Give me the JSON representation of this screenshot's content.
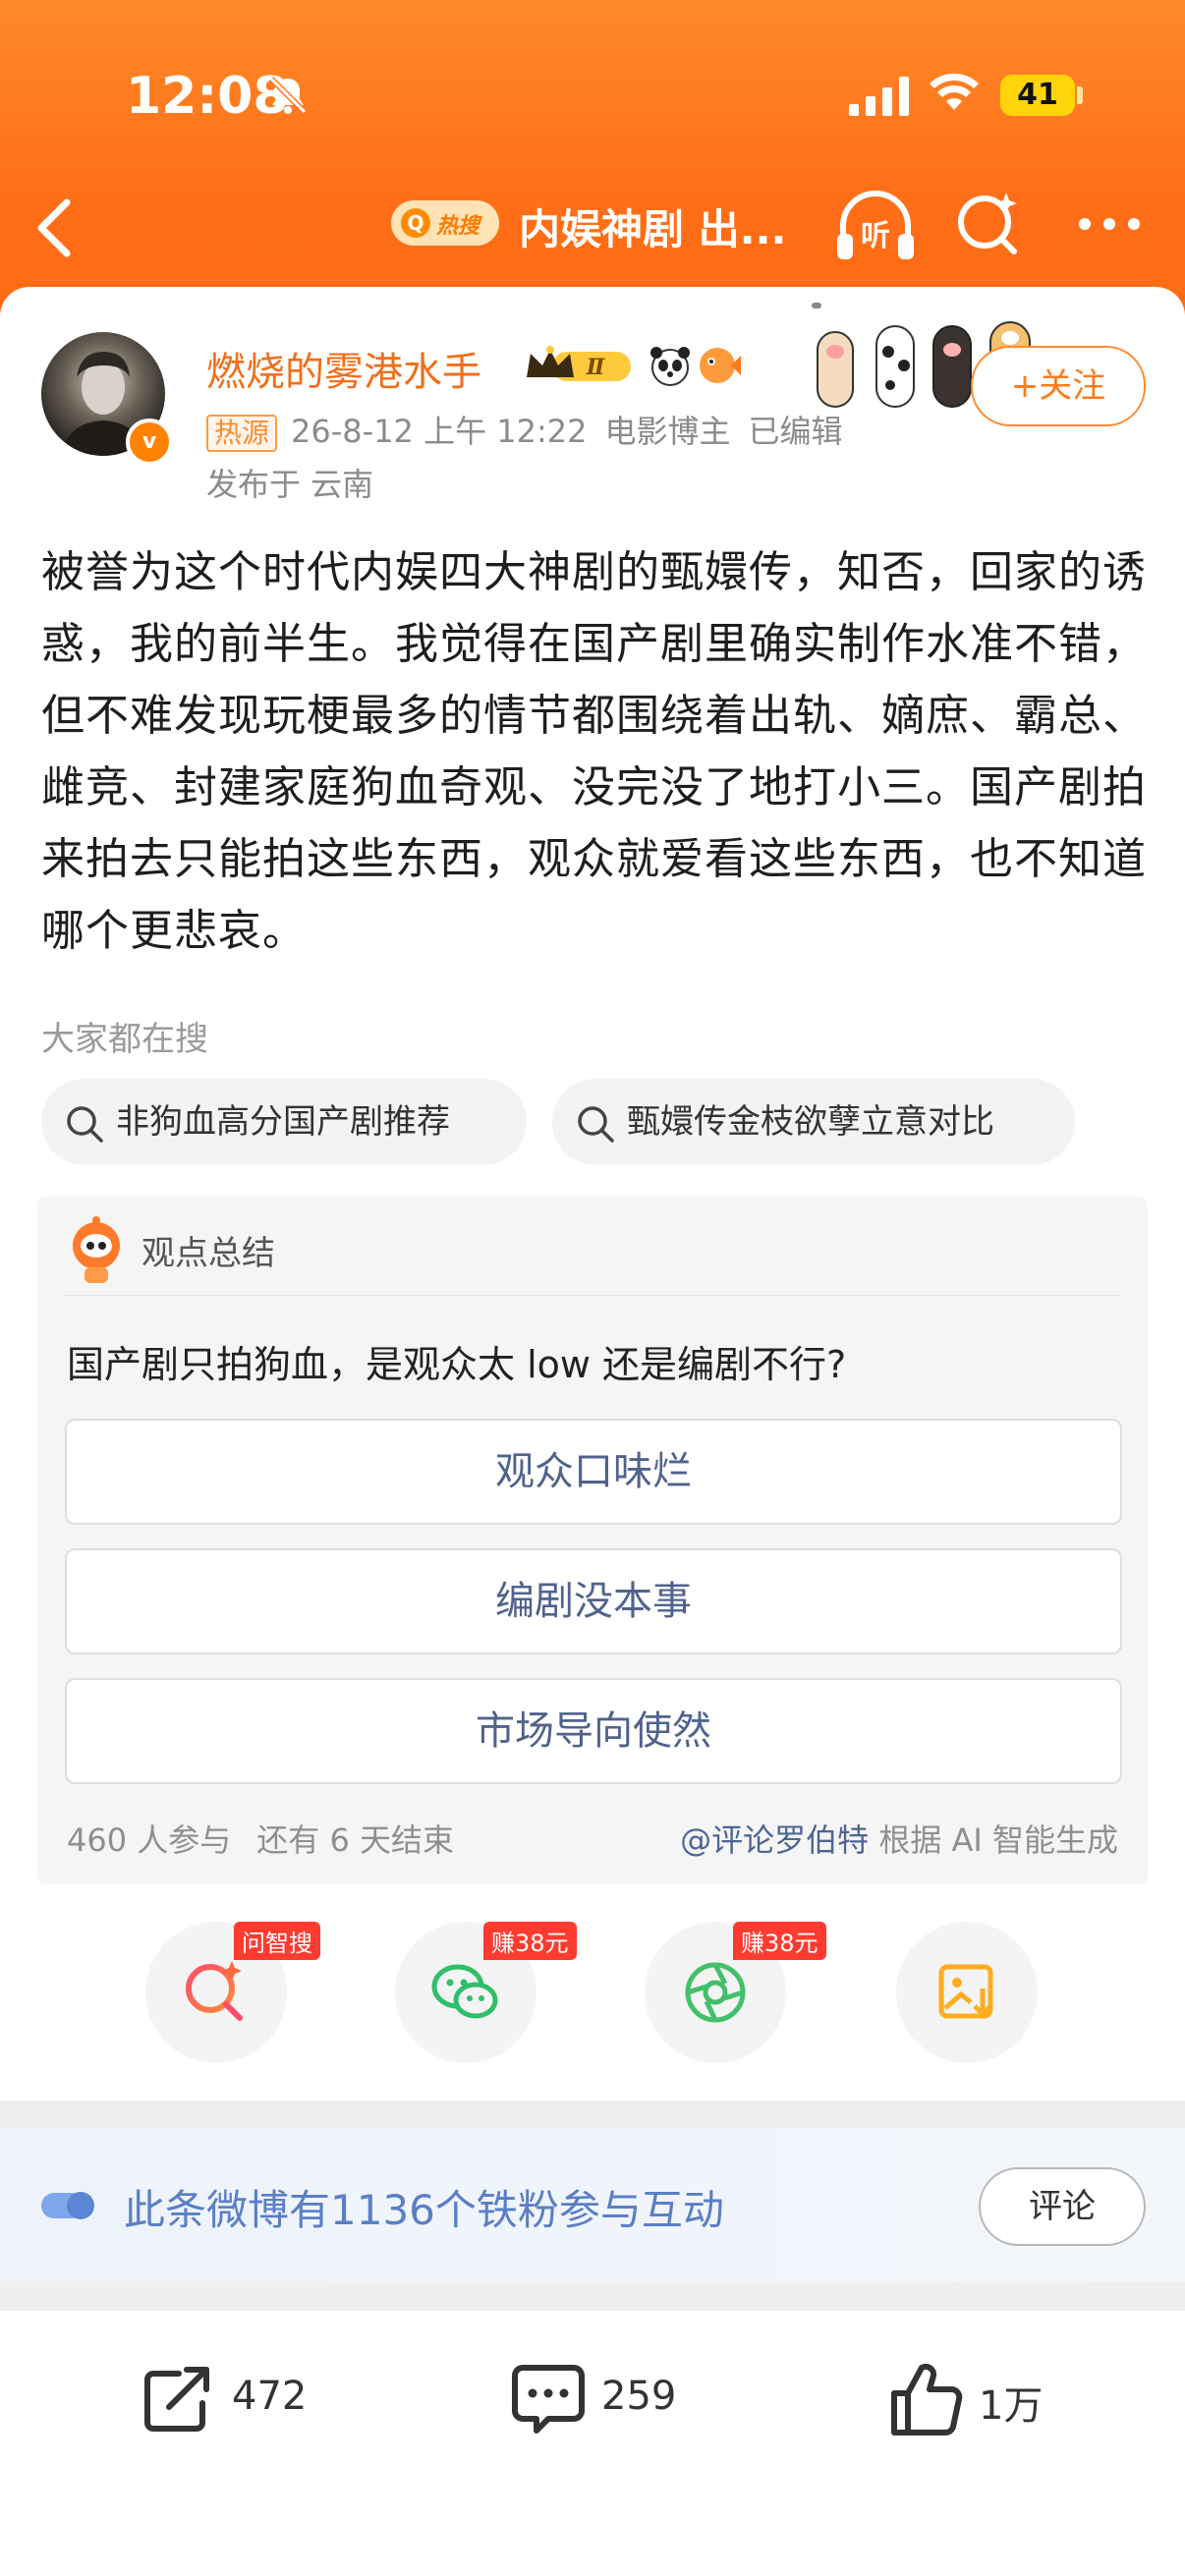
{
  "status_bar": {
    "time": "12:08",
    "battery": "41"
  },
  "nav": {
    "hot_label": "热搜",
    "title": "内娱神剧 出..."
  },
  "post": {
    "author": "燃烧的雾港水手",
    "level_badge": "Ⅱ",
    "follow_label": "+关注",
    "hot_source": "热源",
    "timestamp": "26-8-12 上午 12:22",
    "author_tag": "电影博主",
    "edited": "已编辑",
    "location": "发布于 云南",
    "text": "被誉为这个时代内娱四大神剧的甄嬛传，知否，回家的诱惑，我的前半生。我觉得在国产剧里确实制作水准不错，但不难发现玩梗最多的情节都围绕着出轨、嫡庶、霸总、雌竞、封建家庭狗血奇观、没完没了地打小三。国产剧拍来拍去只能拍这些东西，观众就爱看这些东西，也不知道哪个更悲哀。"
  },
  "search": {
    "heading": "大家都在搜",
    "chips": [
      "非狗血高分国产剧推荐",
      "甄嬛传金枝欲孽立意对比"
    ]
  },
  "summary": {
    "title": "观点总结",
    "question": "国产剧只拍狗血，是观众太 low 还是编剧不行?",
    "options": [
      "观众口味烂",
      "编剧没本事",
      "市场导向使然"
    ],
    "participants": "460 人参与",
    "remaining": "还有 6 天结束",
    "credit_link": "@评论罗伯特",
    "credit_suffix": "根据 AI 智能生成"
  },
  "share_actions": [
    {
      "icon": "ai-search-icon",
      "badge": "问智搜"
    },
    {
      "icon": "wechat-icon",
      "badge": "赚38元"
    },
    {
      "icon": "moments-icon",
      "badge": "赚38元"
    },
    {
      "icon": "save-image-icon",
      "badge": ""
    }
  ],
  "fans_banner": {
    "text": "此条微博有1136个铁粉参与互动",
    "button": "评论"
  },
  "bottom_bar": {
    "reposts": "472",
    "comments": "259",
    "likes": "1万"
  },
  "colors": {
    "header": "#ff7a1f",
    "accent": "#ff8200",
    "link": "#4e6593",
    "fans_text": "#5b7fc6"
  }
}
